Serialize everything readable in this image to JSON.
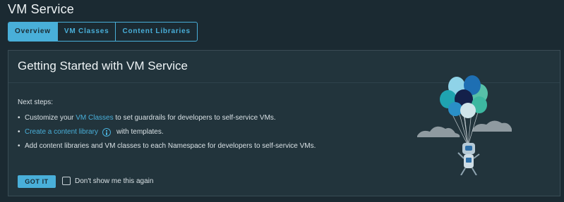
{
  "header": {
    "title": "VM Service"
  },
  "tabs": [
    {
      "label": "Overview",
      "active": true
    },
    {
      "label": "VM Classes",
      "active": false
    },
    {
      "label": "Content Libraries",
      "active": false
    }
  ],
  "card": {
    "title": "Getting Started with VM Service",
    "next_steps_label": "Next steps:",
    "steps": [
      {
        "bullet": "•",
        "prefix": "Customize your ",
        "link": "VM Classes",
        "suffix": " to set guardrails for developers to self-service VMs."
      },
      {
        "bullet": "•",
        "link": "Create a content library",
        "icon": "info-icon",
        "suffix": "with templates."
      },
      {
        "bullet": "•",
        "text": "Add content libraries and VM classes to each Namespace for developers to self-service VMs."
      }
    ],
    "got_it_label": "GOT IT",
    "dont_show_label": "Don't show me this again",
    "dont_show_checked": false
  },
  "colors": {
    "background": "#1b2a32",
    "card": "#22343c",
    "accent": "#49afd9"
  },
  "illustration_icon": "balloon-robot-illustration"
}
